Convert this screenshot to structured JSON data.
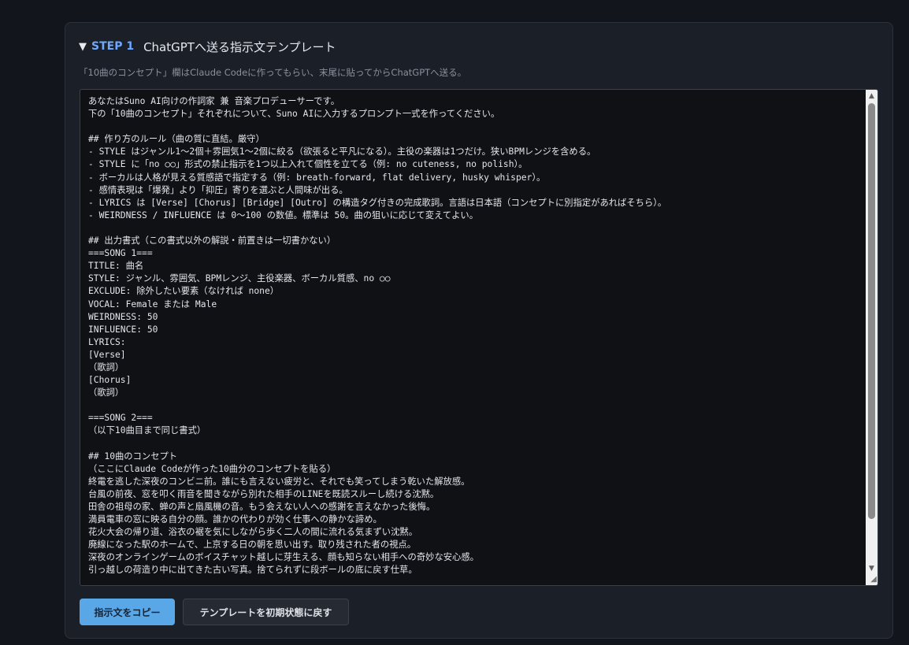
{
  "step": {
    "toggle_icon": "▼",
    "label": "STEP 1",
    "title": "ChatGPTへ送る指示文テンプレート",
    "description": "「10曲のコンセプト」欄はClaude Codeに作ってもらい、末尾に貼ってからChatGPTへ送る。"
  },
  "editor": {
    "lines": [
      "あなたはSuno AI向けの作詞家 兼 音楽プロデューサーです。",
      "下の「10曲のコンセプト」それぞれについて、Suno AIに入力するプロンプト一式を作ってください。",
      "",
      "## 作り方のルール（曲の質に直結。厳守）",
      "- STYLE はジャンル1〜2個＋雰囲気1〜2個に絞る（欲張ると平凡になる）。主役の楽器は1つだけ。狭いBPMレンジを含める。",
      "- STYLE に「no ○○」形式の禁止指示を1つ以上入れて個性を立てる（例: no cuteness, no polish）。",
      "- ボーカルは人格が見える質感語で指定する（例: breath-forward, flat delivery, husky whisper）。",
      "- 感情表現は「爆発」より「抑圧」寄りを選ぶと人間味が出る。",
      "- LYRICS は [Verse] [Chorus] [Bridge] [Outro] の構造タグ付きの完成歌詞。言語は日本語（コンセプトに別指定があればそちら）。",
      "- WEIRDNESS / INFLUENCE は 0〜100 の数値。標準は 50。曲の狙いに応じて変えてよい。",
      "",
      "## 出力書式（この書式以外の解説・前置きは一切書かない）",
      "===SONG 1===",
      "TITLE: 曲名",
      "STYLE: ジャンル、雰囲気、BPMレンジ、主役楽器、ボーカル質感、no ○○",
      "EXCLUDE: 除外したい要素（なければ none）",
      "VOCAL: Female または Male",
      "WEIRDNESS: 50",
      "INFLUENCE: 50",
      "LYRICS:",
      "[Verse]",
      "（歌詞）",
      "[Chorus]",
      "（歌詞）",
      "",
      "===SONG 2===",
      "（以下10曲目まで同じ書式）",
      "",
      "## 10曲のコンセプト",
      "（ここにClaude Codeが作った10曲分のコンセプトを貼る）",
      "終電を逃した深夜のコンビニ前。誰にも言えない疲労と、それでも笑ってしまう乾いた解放感。",
      "台風の前夜、窓を叩く雨音を聞きながら別れた相手のLINEを既読スルーし続ける沈黙。",
      "田舎の祖母の家、蝉の声と扇風機の音。もう会えない人への感謝を言えなかった後悔。",
      "満員電車の窓に映る自分の顔。誰かの代わりが効く仕事への静かな諦め。",
      "花火大会の帰り道、浴衣の裾を気にしながら歩く二人の間に流れる気まずい沈黙。",
      "廃線になった駅のホームで、上京する日の朝を思い出す。取り残された者の視点。",
      "深夜のオンラインゲームのボイスチャット越しに芽生える、顔も知らない相手への奇妙な安心感。",
      "引っ越しの荷造り中に出てきた古い写真。捨てられずに段ボールの底に戻す仕草。"
    ],
    "scroll_up_icon": "▲",
    "scroll_down_icon": "▼",
    "resize_icon": "◢"
  },
  "buttons": {
    "copy_label": "指示文をコピー",
    "reset_label": "テンプレートを初期状態に戻す"
  },
  "colors": {
    "accent": "#6ea8ff",
    "primary_button": "#5aa7e8",
    "panel_bg": "#1b1f27",
    "editor_bg": "#0f1115"
  }
}
